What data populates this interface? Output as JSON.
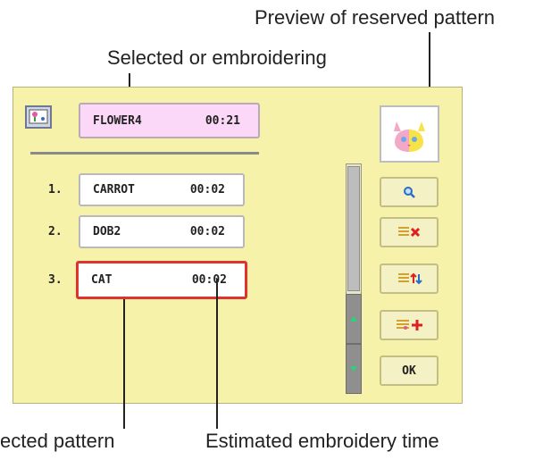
{
  "callouts": {
    "preview": "Preview of reserved pattern",
    "selected": "Selected or embroidering",
    "selected_pattern": "ected pattern",
    "estimated_time": "Estimated embroidery time"
  },
  "current": {
    "name": "FLOWER4",
    "time": "00:21"
  },
  "reserved": [
    {
      "number": "1.",
      "name": "CARROT",
      "time": "00:02"
    },
    {
      "number": "2.",
      "name": "DOB2",
      "time": "00:02"
    },
    {
      "number": "3.",
      "name": "CAT",
      "time": "00:02"
    }
  ],
  "buttons": {
    "ok_label": "OK"
  },
  "icons": {
    "mode": "embroidery-frame-icon",
    "preview": "cat-face-preview-icon",
    "zoom": "magnifier-icon",
    "delete": "list-delete-icon",
    "reorder": "list-reorder-icon",
    "add": "add-pattern-icon",
    "scroll_up": "arrow-up-icon",
    "scroll_down": "arrow-down-icon"
  },
  "colors": {
    "panel": "#f6f2aa",
    "current_box": "#fbd8f8",
    "selected_border": "#e0322e",
    "delete_red": "#e02020"
  }
}
